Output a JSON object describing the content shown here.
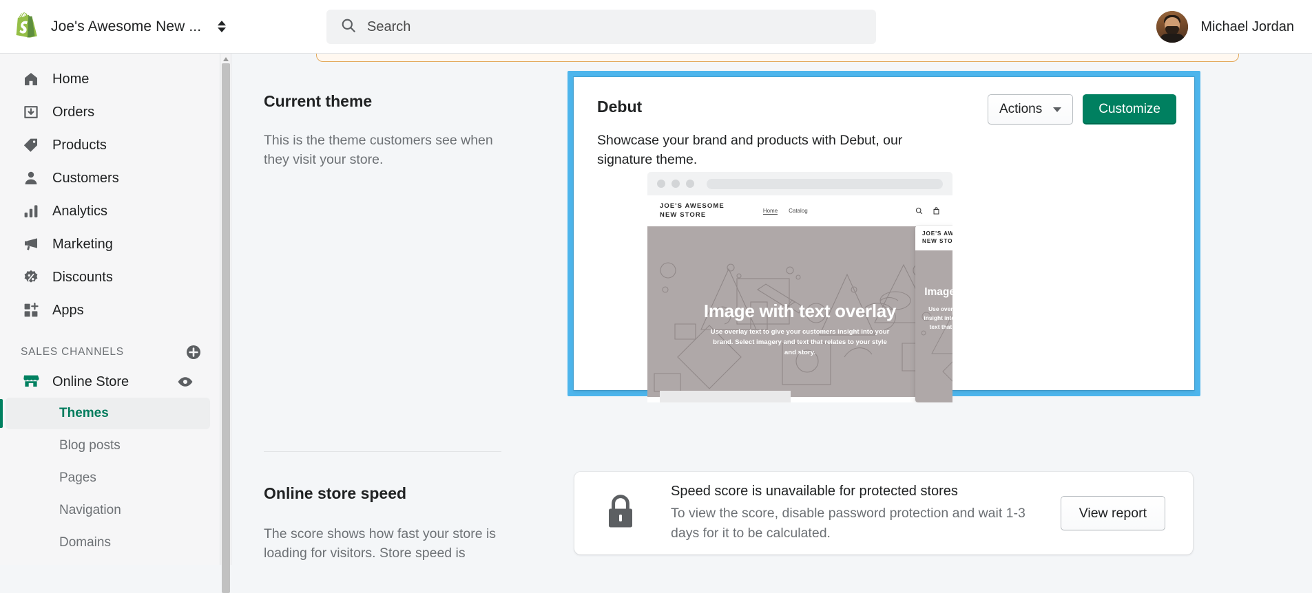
{
  "topbar": {
    "logo_icon": "shopify-bag-icon",
    "store_name": "Joe's Awesome New ...",
    "store_switcher_icon": "updown-caret-icon",
    "search": {
      "icon": "search-icon",
      "placeholder": "Search",
      "value": "Search"
    },
    "user": {
      "name": "Michael Jordan",
      "avatar_icon": "user-avatar-photo"
    }
  },
  "sidebar": {
    "nav_items": [
      {
        "label": "Home",
        "icon": "home-icon"
      },
      {
        "label": "Orders",
        "icon": "orders-inbox-icon"
      },
      {
        "label": "Products",
        "icon": "tag-icon"
      },
      {
        "label": "Customers",
        "icon": "person-icon"
      },
      {
        "label": "Analytics",
        "icon": "bar-chart-icon"
      },
      {
        "label": "Marketing",
        "icon": "megaphone-icon"
      },
      {
        "label": "Discounts",
        "icon": "discount-percent-icon"
      },
      {
        "label": "Apps",
        "icon": "apps-grid-plus-icon"
      }
    ],
    "sales_channels": {
      "title": "SALES CHANNELS",
      "add_icon": "plus-circle-icon",
      "channel": {
        "label": "Online Store",
        "icon": "storefront-icon",
        "view_icon": "eye-icon"
      },
      "sub_items": [
        {
          "label": "Themes",
          "active": true
        },
        {
          "label": "Blog posts",
          "active": false
        },
        {
          "label": "Pages",
          "active": false
        },
        {
          "label": "Navigation",
          "active": false
        },
        {
          "label": "Domains",
          "active": false
        }
      ]
    }
  },
  "main": {
    "current_theme_section": {
      "title": "Current theme",
      "description": "This is the theme customers see when they visit your store."
    },
    "theme_card": {
      "highlighted": true,
      "highlight_color": "#4DB5EC",
      "name": "Debut",
      "description": "Showcase your brand and products with Debut, our signature theme.",
      "actions_button": "Actions",
      "actions_caret_icon": "chevron-down-icon",
      "customize_button": "Customize",
      "customize_color": "#008060",
      "preview": {
        "desktop": {
          "store_logo": "JOE'S AWESOME\nNEW STORE",
          "nav": [
            "Home",
            "Catalog"
          ],
          "icons": [
            "search-icon",
            "shopping-bag-icon"
          ],
          "hero_heading": "Image with text overlay",
          "hero_body": "Use overlay text to give your customers insight into your brand. Select imagery and text that relates to your style and story."
        },
        "mobile": {
          "store_logo": "JOE'S AWESOME\nNEW STORE",
          "icons": [
            "search-icon",
            "shopping-bag-icon",
            "hamburger-menu-icon"
          ],
          "hero_heading": "Image with text overlay",
          "hero_body": "Use overlay text to give your customers insight into your brand. Select imagery and text that relates to your style and story."
        }
      }
    },
    "speed_section": {
      "title": "Online store speed",
      "description": "The score shows how fast your store is loading for visitors. Store speed is affected by"
    },
    "speed_card": {
      "icon": "lock-icon",
      "heading": "Speed score is unavailable for protected stores",
      "body": "To view the score, disable password protection and wait 1-3 days for it to be calculated.",
      "button": "View report"
    }
  }
}
